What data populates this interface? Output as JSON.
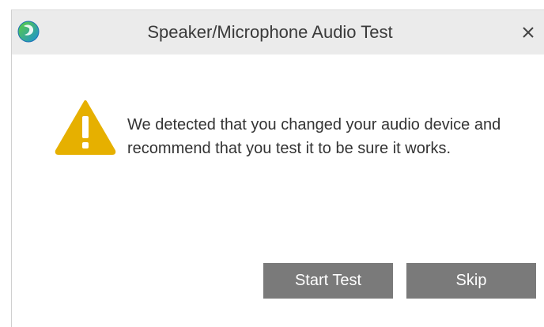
{
  "window": {
    "title": "Speaker/Microphone Audio Test",
    "app_icon": "webex-logo-icon",
    "close_icon": "close-icon"
  },
  "dialog": {
    "warning_icon": "warning-icon",
    "message": "We detected that you changed your audio device and recommend that you test it to be sure it works."
  },
  "buttons": {
    "start_test": "Start Test",
    "skip": "Skip"
  },
  "colors": {
    "titlebar_bg": "#ebebeb",
    "button_bg": "#7a7a7a",
    "warning": "#e6b000"
  }
}
